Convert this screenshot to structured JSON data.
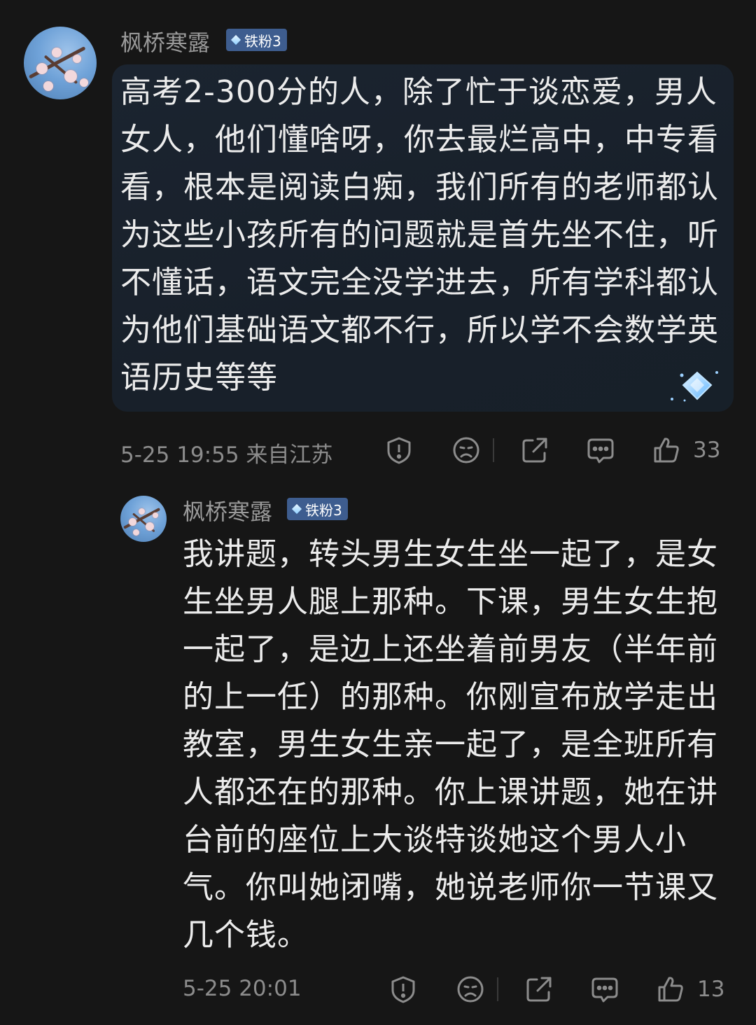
{
  "comments": [
    {
      "user": {
        "name": "枫桥寒露",
        "badge": "铁粉3"
      },
      "text": "高考2-300分的人，除了忙于谈恋爱，男人女人，他们懂啥呀，你去最烂高中，中专看看，根本是阅读白痴，我们所有的老师都认为这些小孩所有的问题就是首先坐不住，听不懂话，语文完全没学进去，所有学科都认为他们基础语文都不行，所以学不会数学英语历史等等",
      "meta": "5-25 19:55 来自江苏",
      "likes": "33",
      "icons": [
        "report-icon",
        "dislike-icon",
        "share-icon",
        "reply-icon",
        "like-icon"
      ]
    },
    {
      "user": {
        "name": "枫桥寒露",
        "badge": "铁粉3"
      },
      "text": "我讲题，转头男生女生坐一起了，是女生坐男人腿上那种。下课，男生女生抱一起了，是边上还坐着前男友（半年前的上一任）的那种。你刚宣布放学走出教室，男生女生亲一起了，是全班所有人都还在的那种。你上课讲题，她在讲台前的座位上大谈特谈她这个男人小气。你叫她闭嘴，她说老师你一节课又几个钱。",
      "meta": "5-25 20:01",
      "likes": "13",
      "icons": [
        "report-icon",
        "dislike-icon",
        "share-icon",
        "reply-icon",
        "like-icon"
      ]
    }
  ],
  "colors": {
    "background": "#161616",
    "bubble": "#1b2430",
    "badge": "#3e5d8f",
    "meta_text": "#8c8c8c"
  }
}
